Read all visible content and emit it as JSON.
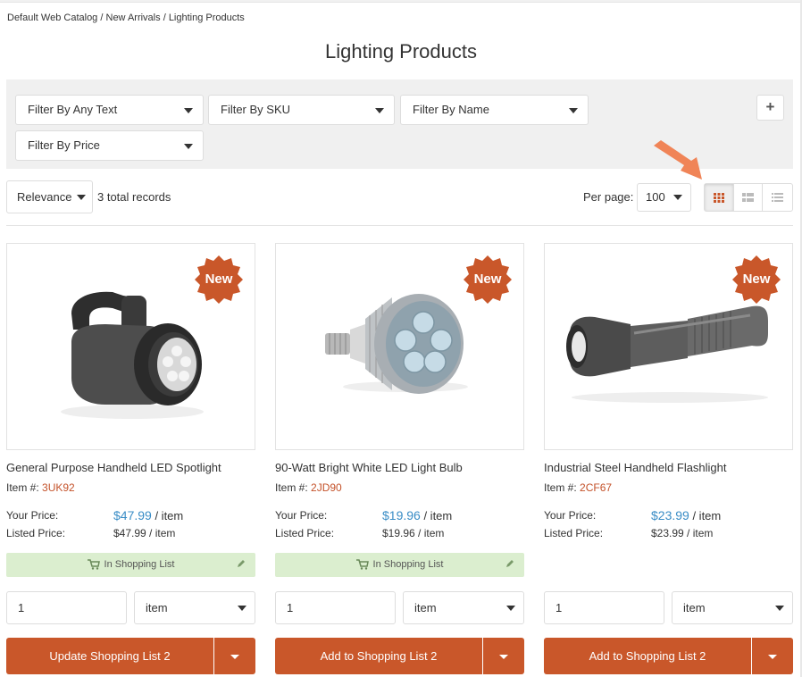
{
  "breadcrumb": {
    "items": [
      "Default Web Catalog",
      "New Arrivals",
      "Lighting Products"
    ],
    "separator": "/"
  },
  "page_title": "Lighting Products",
  "filters": [
    {
      "label": "Filter By Any Text"
    },
    {
      "label": "Filter By SKU"
    },
    {
      "label": "Filter By Name"
    },
    {
      "label": "Filter By Price"
    }
  ],
  "add_filter": "+",
  "toolbar": {
    "sort": "Relevance",
    "total": "3 total records",
    "per_page_label": "Per page:",
    "per_page": "100",
    "views": [
      {
        "name": "grid-view-icon",
        "active": true
      },
      {
        "name": "list-view-icon",
        "active": false
      },
      {
        "name": "compact-list-view-icon",
        "active": false
      }
    ]
  },
  "products": [
    {
      "name": "General Purpose Handheld LED Spotlight",
      "item_label": "Item #:",
      "sku": "3UK92",
      "badge": "New",
      "your_price_label": "Your Price:",
      "your_price": "$47.99",
      "your_price_unit": "/ item",
      "listed_price_label": "Listed Price:",
      "listed_price": "$47.99 / item",
      "in_list": "In Shopping List",
      "quantity": "1",
      "unit": "item",
      "button": "Update Shopping List 2",
      "image": "spotlight"
    },
    {
      "name": "90-Watt Bright White LED Light Bulb",
      "item_label": "Item #:",
      "sku": "2JD90",
      "badge": "New",
      "your_price_label": "Your Price:",
      "your_price": "$19.96",
      "your_price_unit": "/ item",
      "listed_price_label": "Listed Price:",
      "listed_price": "$19.96 / item",
      "in_list": "In Shopping List",
      "quantity": "1",
      "unit": "item",
      "button": "Add to Shopping List 2",
      "image": "bulb"
    },
    {
      "name": "Industrial Steel Handheld Flashlight",
      "item_label": "Item #:",
      "sku": "2CF67",
      "badge": "New",
      "your_price_label": "Your Price:",
      "your_price": "$23.99",
      "your_price_unit": "/ item",
      "listed_price_label": "Listed Price:",
      "listed_price": "$23.99 / item",
      "in_list": null,
      "quantity": "1",
      "unit": "item",
      "button": "Add to Shopping List 2",
      "image": "flashlight"
    }
  ],
  "colors": {
    "accent": "#c9572a",
    "price": "#3a8dc6",
    "in_list_bg": "#dbeecf",
    "arrow": "#f08457"
  }
}
